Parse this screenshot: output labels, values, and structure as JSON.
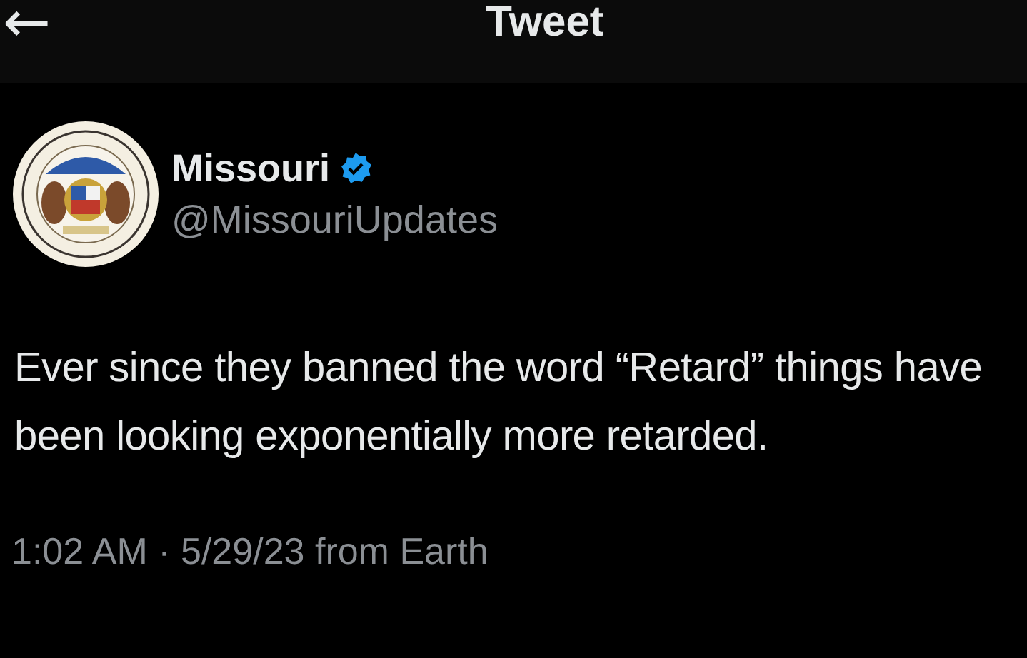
{
  "header": {
    "back": "←",
    "title": "Tweet"
  },
  "tweet": {
    "author": {
      "name": "Missouri",
      "verified": true,
      "handle": "@MissouriUpdates"
    },
    "text": "Ever since they banned the word “Retard” things have been looking exponentially more retarded.",
    "timestamp": "1:02 AM · 5/29/23 from Earth"
  }
}
